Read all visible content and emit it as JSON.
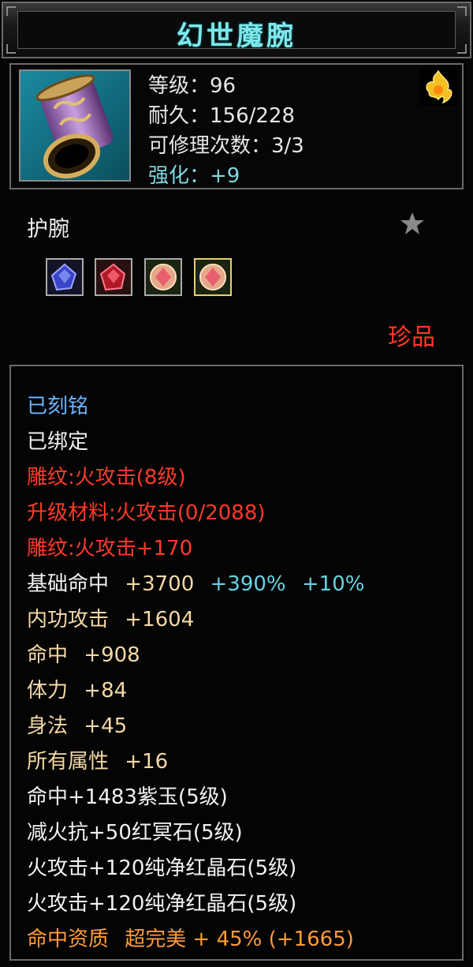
{
  "item": {
    "name": "幻世魔腕",
    "stats": {
      "level": "等级：96",
      "durability": "耐久：156/228",
      "repairs": "可修理次数：3/3",
      "enhance": "强化：+9"
    },
    "type": "护腕",
    "quality": "珍品",
    "gems": [
      "blue-gem-icon",
      "red-gem-icon",
      "pink-gem-icon",
      "pink-gem-icon"
    ]
  },
  "attributes": {
    "engraved": "已刻铭",
    "bound": "已绑定",
    "carving": "雕纹:火攻击(8级)",
    "upgrade_material": "升级材料:火攻击(0/2088)",
    "carving_bonus": "雕纹:火攻击+170",
    "base_hit_label": "基础命中",
    "base_hit_value": "+3700",
    "base_hit_pct1": "+390%",
    "base_hit_pct2": "+10%",
    "inner_attack_label": "内功攻击",
    "inner_attack_value": "+1604",
    "hit_label": "命中",
    "hit_value": "+908",
    "stamina_label": "体力",
    "stamina_value": "+84",
    "agility_label": "身法",
    "agility_value": "+45",
    "all_attr_label": "所有属性",
    "all_attr_value": "+16",
    "gem_line_1": "命中+1483紫玉(5级)",
    "gem_line_2": "减火抗+50红冥石(5级)",
    "gem_line_3": "火攻击+120纯净红晶石(5级)",
    "gem_line_4": "火攻击+120纯净红晶石(5级)",
    "aptitude_label": "命中资质",
    "aptitude_value": "超完美 + 45% (+1665)"
  },
  "colors": {
    "title": "#7ee8ec",
    "engraved": "#6bb4ff",
    "red": "#ff3a2a",
    "tan": "#f4d8a6",
    "teal": "#66d4e4",
    "orange": "#ff9b3a"
  }
}
